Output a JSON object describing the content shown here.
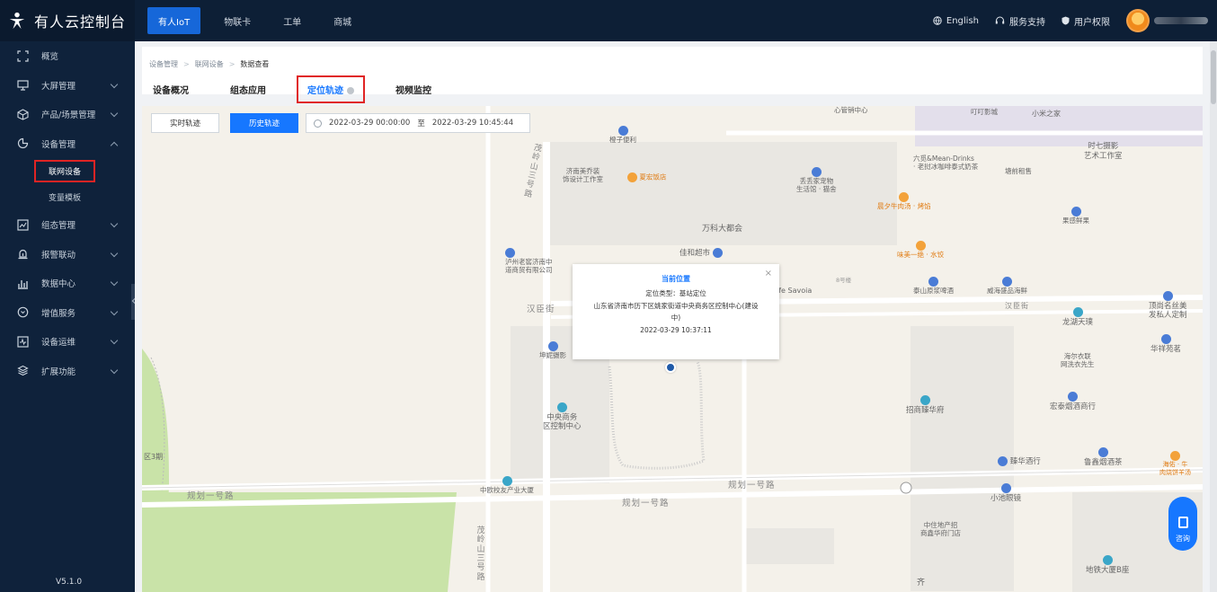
{
  "brand": {
    "title": "有人云控制台"
  },
  "topnav": {
    "items": [
      "有人IoT",
      "物联卡",
      "工单",
      "商城"
    ]
  },
  "topright": {
    "language": "English",
    "support": "服务支持",
    "permissions": "用户权限"
  },
  "sidebar": {
    "items": [
      {
        "label": "概览",
        "icon": "dashboard-icon"
      },
      {
        "label": "大屏管理",
        "icon": "monitor-icon"
      },
      {
        "label": "产品/场景管理",
        "icon": "cube-icon"
      },
      {
        "label": "设备管理",
        "icon": "device-icon",
        "expanded": true
      },
      {
        "label": "组态管理",
        "icon": "config-icon"
      },
      {
        "label": "报警联动",
        "icon": "alarm-icon"
      },
      {
        "label": "数据中心",
        "icon": "chart-icon"
      },
      {
        "label": "增值服务",
        "icon": "service-icon"
      },
      {
        "label": "设备运维",
        "icon": "ops-icon"
      },
      {
        "label": "扩展功能",
        "icon": "extension-icon"
      }
    ],
    "sub_items": [
      "联网设备",
      "变量模板"
    ],
    "version": "V5.1.0"
  },
  "breadcrumb": [
    "设备管理",
    "联网设备",
    "数据查看"
  ],
  "tabs": [
    "设备概况",
    "组态应用",
    "定位轨迹",
    "视频监控"
  ],
  "map_controls": {
    "realtime": "实时轨迹",
    "history": "历史轨迹",
    "start": "2022-03-29 00:00:00",
    "to": "至",
    "end": "2022-03-29 10:45:44"
  },
  "popup": {
    "title": "当前位置",
    "type": "定位类型：基站定位",
    "address": "山东省济南市历下区姚家街道中央商务区控制中心(建设",
    "address2": "中)",
    "time": "2022-03-29 10:37:11",
    "close": "×"
  },
  "map_labels": {
    "poi_cz": "橙子便利",
    "poi_jnmq": "济南美乔装",
    "poi_jnmq2": "饰设计工作室",
    "poi_xh": "夏宏饭店",
    "poi_wk": "万科大都会",
    "poi_jh": "佳和超市",
    "poi_lz1": "泸州老窖济南中",
    "poi_lz2": "道商贸有限公司",
    "poi_dd1": "丢丢家宠物",
    "poi_dd2": "生活馆 · 猫舍",
    "poi_cafe": "ffe Savoia",
    "poi_8": "8号楼",
    "poi_xy": "晨夕牛肉汤 · 烤馅",
    "poi_wm": "味美一绝 · 水饺",
    "poi_ts": "泰山原浆啤酒",
    "poi_wh1": "威海盛品海鲜",
    "poi_ds": "叮叮影城",
    "poi_xm": "小米之家",
    "poi_lb1": "六觅&Mean-Drinks",
    "poi_lb2": "· 老挝冰咖啡泰式奶茶",
    "poi_tq": "塘前租售",
    "poi_sq1": "时七摄影",
    "poi_sq2": "艺术工作室",
    "poi_gg": "果感鲜果",
    "poi_xc": "心管销中心",
    "poi_kn": "坤妮摄影",
    "poi_zy1": "中央商务",
    "poi_zy2": "区控制中心",
    "poi_zs": "招商臻华府",
    "poi_lh": "龙湖天璞",
    "poi_hr1": "海尔衣联",
    "poi_hr2": "网洗衣先生",
    "poi_ht": "宏泰烟酒商行",
    "poi_hx": "华祥苑茗",
    "poi_ds2": "顶尚名丝美",
    "poi_ds3": "发私人定制",
    "poi_zh": "臻华酒行",
    "poi_lx": "鲁鑫烟酒茶",
    "poi_hy1": "海佑 · 牛",
    "poi_hy2": "肉烧饼羊汤",
    "poi_zo": "中欧校友产业大厦",
    "poi_xc2": "小池眼镜",
    "poi_zz1": "中住地产招",
    "poi_zz2": "商鑫华府门店",
    "poi_dt": "地铁大厦B座",
    "poi_q3": "区3期",
    "poi_qi": "齐",
    "road_hcj": "汉臣街",
    "road_hcj2": "汉臣街",
    "road_gh1": "规划一号路",
    "road_gh2": "规划一号路",
    "road_gh3": "规划一号路",
    "road_mls1": "茂岭山三号路",
    "road_mls2": "茂岭山三号路"
  },
  "fab": {
    "label": "咨询"
  }
}
